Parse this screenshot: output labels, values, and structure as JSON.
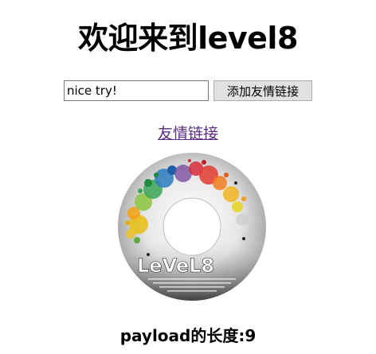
{
  "page": {
    "title": "欢迎来到level8",
    "payload_length_text": "payload的长度:9"
  },
  "form": {
    "keyword_value": "nice try!",
    "submit_label": "添加友情链接"
  },
  "link": {
    "label": "友情链接"
  },
  "disc_image": {
    "logo_text": "LeVeL8"
  },
  "colors": {
    "link": "#5a2d82",
    "button_bg": "#e1e1e1",
    "input_border": "#7a7a7a",
    "disc_ring": "#cfcfcf"
  }
}
